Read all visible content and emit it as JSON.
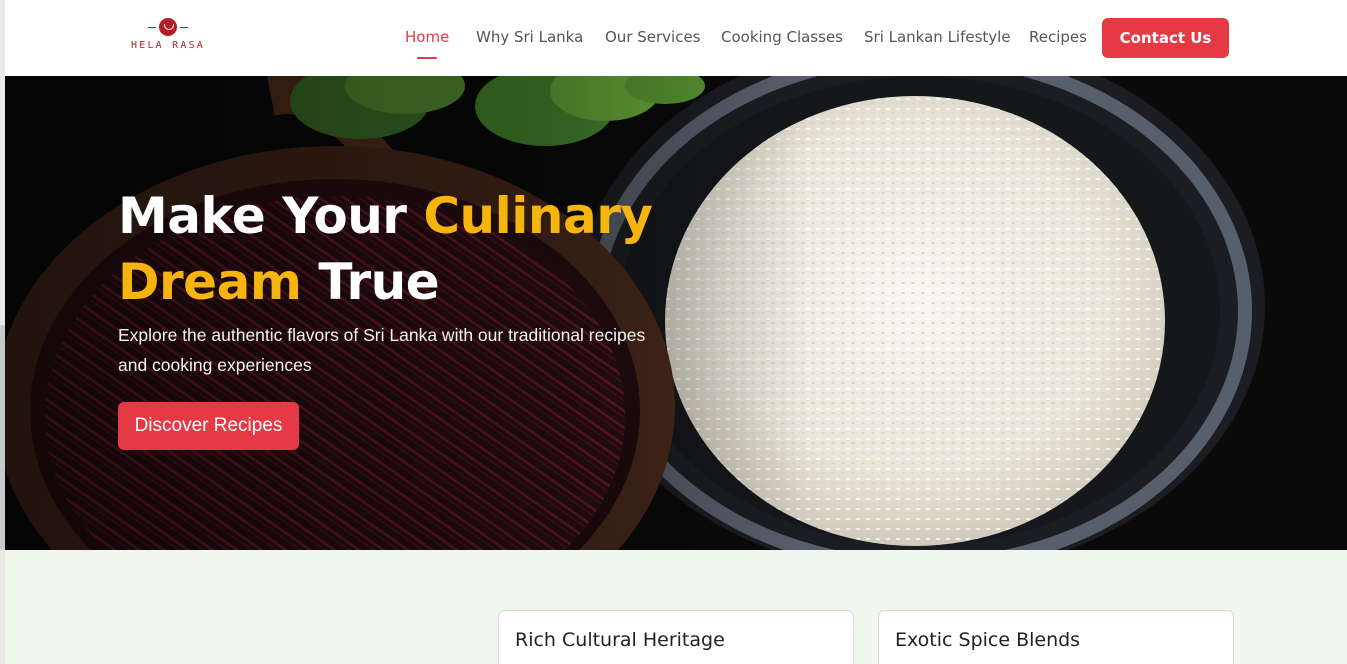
{
  "brand": {
    "name": "HELA RASA",
    "color": "#b71c2a"
  },
  "nav": {
    "items": [
      {
        "label": "Home",
        "active": true
      },
      {
        "label": "Why Sri Lanka",
        "active": false
      },
      {
        "label": "Our Services",
        "active": false
      },
      {
        "label": "Cooking Classes",
        "active": false
      },
      {
        "label": "Sri Lankan Lifestyle",
        "active": false
      },
      {
        "label": "Recipes",
        "active": false
      }
    ],
    "cta": "Contact Us",
    "active_color": "#e63946"
  },
  "hero": {
    "title_part1": "Make Your ",
    "title_highlight1": "Culinary",
    "title_highlight2": "Dream",
    "title_part2": " True",
    "subtitle": "Explore the authentic flavors of Sri Lanka with our traditional recipes and cooking experiences",
    "button": "Discover Recipes",
    "highlight_color": "#f6b40e"
  },
  "features": {
    "cards": [
      {
        "title": "Rich Cultural Heritage"
      },
      {
        "title": "Exotic Spice Blends"
      }
    ]
  }
}
